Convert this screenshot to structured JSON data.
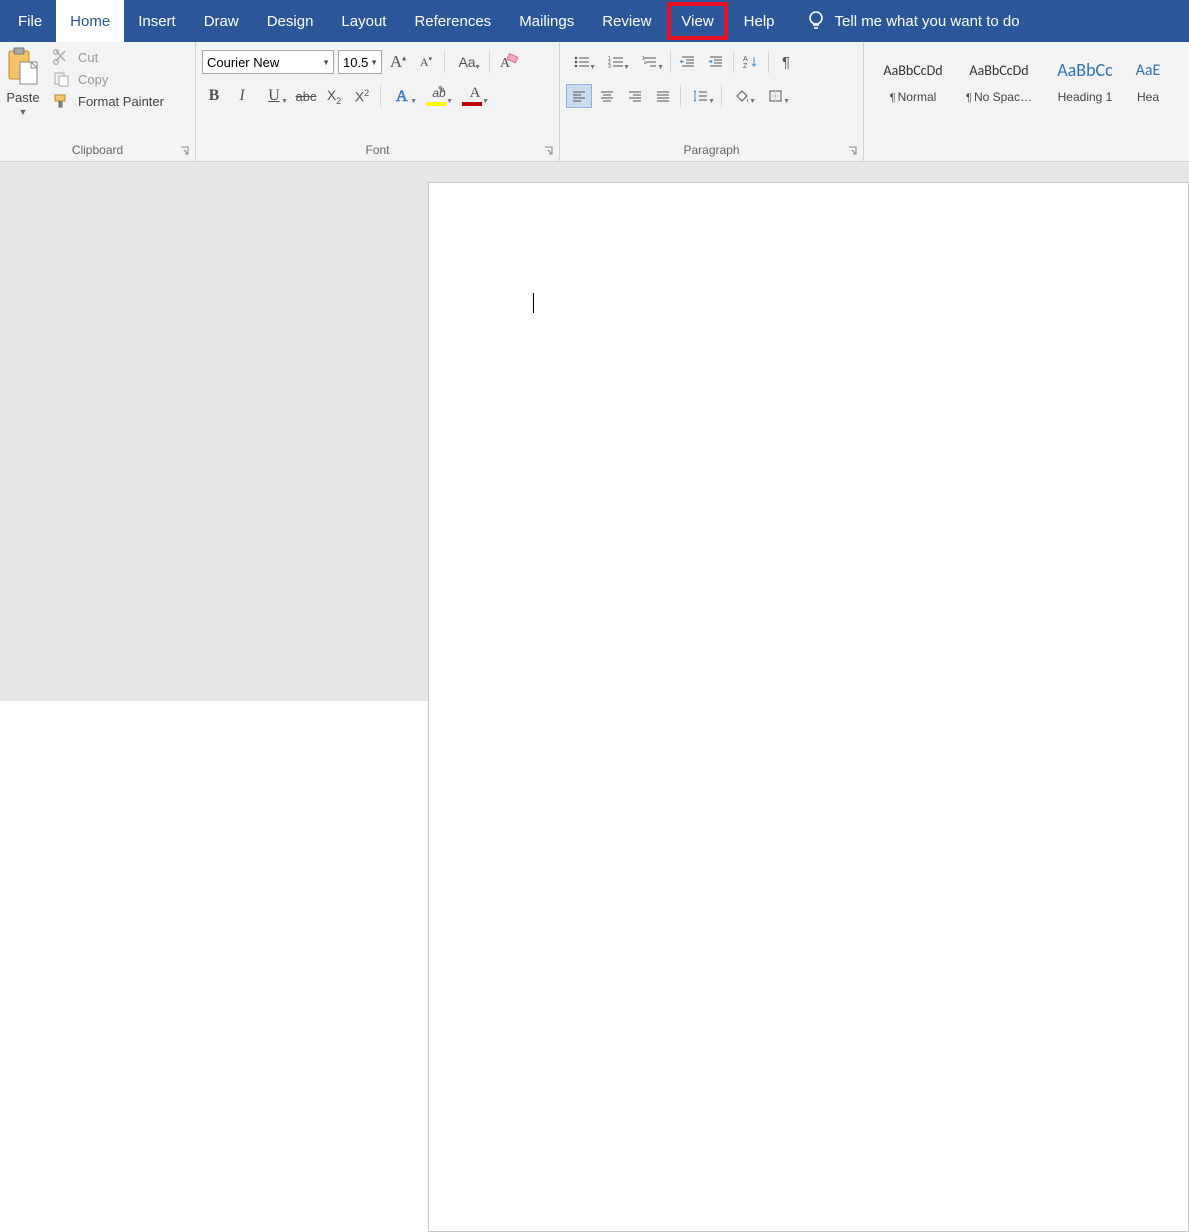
{
  "tabs": {
    "file": "File",
    "home": "Home",
    "insert": "Insert",
    "draw": "Draw",
    "design": "Design",
    "layout": "Layout",
    "references": "References",
    "mailings": "Mailings",
    "review": "Review",
    "view": "View",
    "help": "Help"
  },
  "tell_me": "Tell me what you want to do",
  "clipboard": {
    "paste": "Paste",
    "cut": "Cut",
    "copy": "Copy",
    "format_painter": "Format Painter",
    "label": "Clipboard"
  },
  "font": {
    "name": "Courier New",
    "size": "10.5",
    "label": "Font"
  },
  "paragraph": {
    "label": "Paragraph"
  },
  "styles": {
    "preview": "AaBbCcDd",
    "preview_heading1": "AaBbCc",
    "preview_heading2": "AaE",
    "normal": "Normal",
    "nospacing": "No Spac…",
    "heading1": "Heading 1",
    "heading2": "Hea"
  }
}
